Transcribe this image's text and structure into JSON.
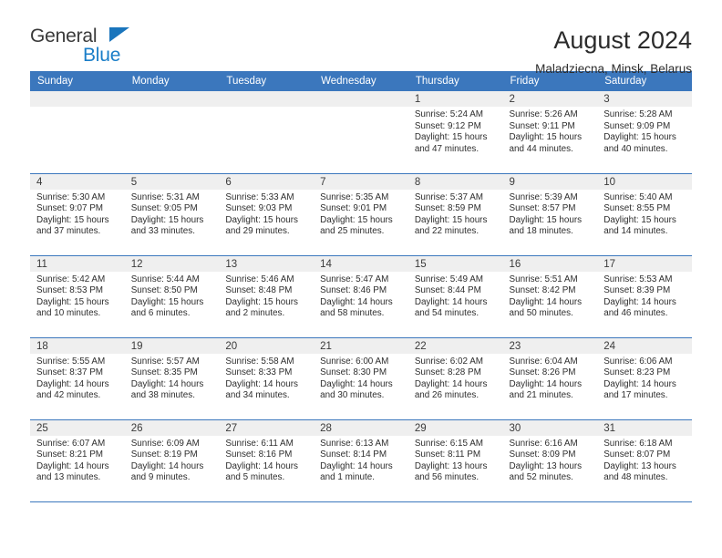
{
  "logo": {
    "word1": "General",
    "word2": "Blue",
    "triangle_color": "#1a75bc",
    "word2_color": "#1a7ec8"
  },
  "header": {
    "title": "August 2024",
    "subtitle": "Maladziecna, Minsk, Belarus"
  },
  "theme": {
    "header_blue": "#3b77bd",
    "band_gray": "#efefef",
    "text": "#2e2e2e"
  },
  "weekdays": [
    "Sunday",
    "Monday",
    "Tuesday",
    "Wednesday",
    "Thursday",
    "Friday",
    "Saturday"
  ],
  "weeks": [
    [
      {
        "day": "",
        "sunrise": "",
        "sunset": "",
        "daylight1": "",
        "daylight2": ""
      },
      {
        "day": "",
        "sunrise": "",
        "sunset": "",
        "daylight1": "",
        "daylight2": ""
      },
      {
        "day": "",
        "sunrise": "",
        "sunset": "",
        "daylight1": "",
        "daylight2": ""
      },
      {
        "day": "",
        "sunrise": "",
        "sunset": "",
        "daylight1": "",
        "daylight2": ""
      },
      {
        "day": "1",
        "sunrise": "Sunrise: 5:24 AM",
        "sunset": "Sunset: 9:12 PM",
        "daylight1": "Daylight: 15 hours",
        "daylight2": "and 47 minutes."
      },
      {
        "day": "2",
        "sunrise": "Sunrise: 5:26 AM",
        "sunset": "Sunset: 9:11 PM",
        "daylight1": "Daylight: 15 hours",
        "daylight2": "and 44 minutes."
      },
      {
        "day": "3",
        "sunrise": "Sunrise: 5:28 AM",
        "sunset": "Sunset: 9:09 PM",
        "daylight1": "Daylight: 15 hours",
        "daylight2": "and 40 minutes."
      }
    ],
    [
      {
        "day": "4",
        "sunrise": "Sunrise: 5:30 AM",
        "sunset": "Sunset: 9:07 PM",
        "daylight1": "Daylight: 15 hours",
        "daylight2": "and 37 minutes."
      },
      {
        "day": "5",
        "sunrise": "Sunrise: 5:31 AM",
        "sunset": "Sunset: 9:05 PM",
        "daylight1": "Daylight: 15 hours",
        "daylight2": "and 33 minutes."
      },
      {
        "day": "6",
        "sunrise": "Sunrise: 5:33 AM",
        "sunset": "Sunset: 9:03 PM",
        "daylight1": "Daylight: 15 hours",
        "daylight2": "and 29 minutes."
      },
      {
        "day": "7",
        "sunrise": "Sunrise: 5:35 AM",
        "sunset": "Sunset: 9:01 PM",
        "daylight1": "Daylight: 15 hours",
        "daylight2": "and 25 minutes."
      },
      {
        "day": "8",
        "sunrise": "Sunrise: 5:37 AM",
        "sunset": "Sunset: 8:59 PM",
        "daylight1": "Daylight: 15 hours",
        "daylight2": "and 22 minutes."
      },
      {
        "day": "9",
        "sunrise": "Sunrise: 5:39 AM",
        "sunset": "Sunset: 8:57 PM",
        "daylight1": "Daylight: 15 hours",
        "daylight2": "and 18 minutes."
      },
      {
        "day": "10",
        "sunrise": "Sunrise: 5:40 AM",
        "sunset": "Sunset: 8:55 PM",
        "daylight1": "Daylight: 15 hours",
        "daylight2": "and 14 minutes."
      }
    ],
    [
      {
        "day": "11",
        "sunrise": "Sunrise: 5:42 AM",
        "sunset": "Sunset: 8:53 PM",
        "daylight1": "Daylight: 15 hours",
        "daylight2": "and 10 minutes."
      },
      {
        "day": "12",
        "sunrise": "Sunrise: 5:44 AM",
        "sunset": "Sunset: 8:50 PM",
        "daylight1": "Daylight: 15 hours",
        "daylight2": "and 6 minutes."
      },
      {
        "day": "13",
        "sunrise": "Sunrise: 5:46 AM",
        "sunset": "Sunset: 8:48 PM",
        "daylight1": "Daylight: 15 hours",
        "daylight2": "and 2 minutes."
      },
      {
        "day": "14",
        "sunrise": "Sunrise: 5:47 AM",
        "sunset": "Sunset: 8:46 PM",
        "daylight1": "Daylight: 14 hours",
        "daylight2": "and 58 minutes."
      },
      {
        "day": "15",
        "sunrise": "Sunrise: 5:49 AM",
        "sunset": "Sunset: 8:44 PM",
        "daylight1": "Daylight: 14 hours",
        "daylight2": "and 54 minutes."
      },
      {
        "day": "16",
        "sunrise": "Sunrise: 5:51 AM",
        "sunset": "Sunset: 8:42 PM",
        "daylight1": "Daylight: 14 hours",
        "daylight2": "and 50 minutes."
      },
      {
        "day": "17",
        "sunrise": "Sunrise: 5:53 AM",
        "sunset": "Sunset: 8:39 PM",
        "daylight1": "Daylight: 14 hours",
        "daylight2": "and 46 minutes."
      }
    ],
    [
      {
        "day": "18",
        "sunrise": "Sunrise: 5:55 AM",
        "sunset": "Sunset: 8:37 PM",
        "daylight1": "Daylight: 14 hours",
        "daylight2": "and 42 minutes."
      },
      {
        "day": "19",
        "sunrise": "Sunrise: 5:57 AM",
        "sunset": "Sunset: 8:35 PM",
        "daylight1": "Daylight: 14 hours",
        "daylight2": "and 38 minutes."
      },
      {
        "day": "20",
        "sunrise": "Sunrise: 5:58 AM",
        "sunset": "Sunset: 8:33 PM",
        "daylight1": "Daylight: 14 hours",
        "daylight2": "and 34 minutes."
      },
      {
        "day": "21",
        "sunrise": "Sunrise: 6:00 AM",
        "sunset": "Sunset: 8:30 PM",
        "daylight1": "Daylight: 14 hours",
        "daylight2": "and 30 minutes."
      },
      {
        "day": "22",
        "sunrise": "Sunrise: 6:02 AM",
        "sunset": "Sunset: 8:28 PM",
        "daylight1": "Daylight: 14 hours",
        "daylight2": "and 26 minutes."
      },
      {
        "day": "23",
        "sunrise": "Sunrise: 6:04 AM",
        "sunset": "Sunset: 8:26 PM",
        "daylight1": "Daylight: 14 hours",
        "daylight2": "and 21 minutes."
      },
      {
        "day": "24",
        "sunrise": "Sunrise: 6:06 AM",
        "sunset": "Sunset: 8:23 PM",
        "daylight1": "Daylight: 14 hours",
        "daylight2": "and 17 minutes."
      }
    ],
    [
      {
        "day": "25",
        "sunrise": "Sunrise: 6:07 AM",
        "sunset": "Sunset: 8:21 PM",
        "daylight1": "Daylight: 14 hours",
        "daylight2": "and 13 minutes."
      },
      {
        "day": "26",
        "sunrise": "Sunrise: 6:09 AM",
        "sunset": "Sunset: 8:19 PM",
        "daylight1": "Daylight: 14 hours",
        "daylight2": "and 9 minutes."
      },
      {
        "day": "27",
        "sunrise": "Sunrise: 6:11 AM",
        "sunset": "Sunset: 8:16 PM",
        "daylight1": "Daylight: 14 hours",
        "daylight2": "and 5 minutes."
      },
      {
        "day": "28",
        "sunrise": "Sunrise: 6:13 AM",
        "sunset": "Sunset: 8:14 PM",
        "daylight1": "Daylight: 14 hours",
        "daylight2": "and 1 minute."
      },
      {
        "day": "29",
        "sunrise": "Sunrise: 6:15 AM",
        "sunset": "Sunset: 8:11 PM",
        "daylight1": "Daylight: 13 hours",
        "daylight2": "and 56 minutes."
      },
      {
        "day": "30",
        "sunrise": "Sunrise: 6:16 AM",
        "sunset": "Sunset: 8:09 PM",
        "daylight1": "Daylight: 13 hours",
        "daylight2": "and 52 minutes."
      },
      {
        "day": "31",
        "sunrise": "Sunrise: 6:18 AM",
        "sunset": "Sunset: 8:07 PM",
        "daylight1": "Daylight: 13 hours",
        "daylight2": "and 48 minutes."
      }
    ]
  ]
}
